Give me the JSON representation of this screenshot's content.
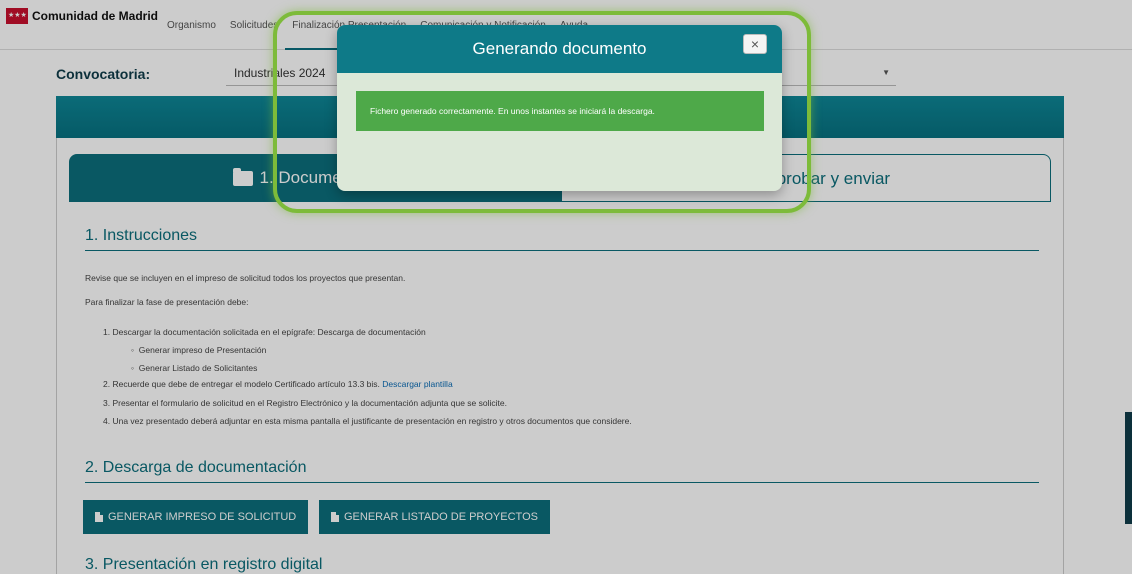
{
  "header": {
    "brand": "Comunidad de Madrid",
    "nav": [
      "Organismo",
      "Solicitudes",
      "Finalización Presentación",
      "Comunicación y Notificación",
      "Ayuda"
    ]
  },
  "convocatoria": {
    "label": "Convocatoria:",
    "value": "Industriales 2024"
  },
  "tabs": {
    "tab1": "1. Documentación",
    "tab2": "2. Comprobar y enviar"
  },
  "instructions": {
    "title": "1. Instrucciones",
    "p1": "Revise que se incluyen en el impreso de solicitud todos los proyectos que presentan.",
    "p2": "Para finalizar la fase de presentación debe:",
    "item1": "1. Descargar la documentación solicitada en el epígrafe: Descarga de documentación",
    "sub1": "Generar impreso de Presentación",
    "sub2": "Generar Listado de Solicitantes",
    "item2": "2. Recuerde que debe de entregar el modelo Certificado artículo 13.3 bis.",
    "item2_link": "Descargar plantilla",
    "item3": "3. Presentar el formulario de solicitud en el Registro Electrónico y la documentación adjunta que se solicite.",
    "item4": "4. Una vez presentado deberá adjuntar en esta misma pantalla el justificante de presentación en registro y otros documentos que considere."
  },
  "download": {
    "title": "2. Descarga de documentación",
    "btn1": "GENERAR IMPRESO DE SOLICITUD",
    "btn2": "GENERAR LISTADO DE PROYECTOS"
  },
  "registro": {
    "title": "3. Presentación en registro digital"
  },
  "modal": {
    "title": "Generando documento",
    "close": "×",
    "message": "Fichero generado correctamente. En unos instantes se iniciará la descarga."
  },
  "colors": {
    "accent": "#0c6f7c",
    "success": "#4ea949",
    "highlight": "#7dbb3a"
  }
}
